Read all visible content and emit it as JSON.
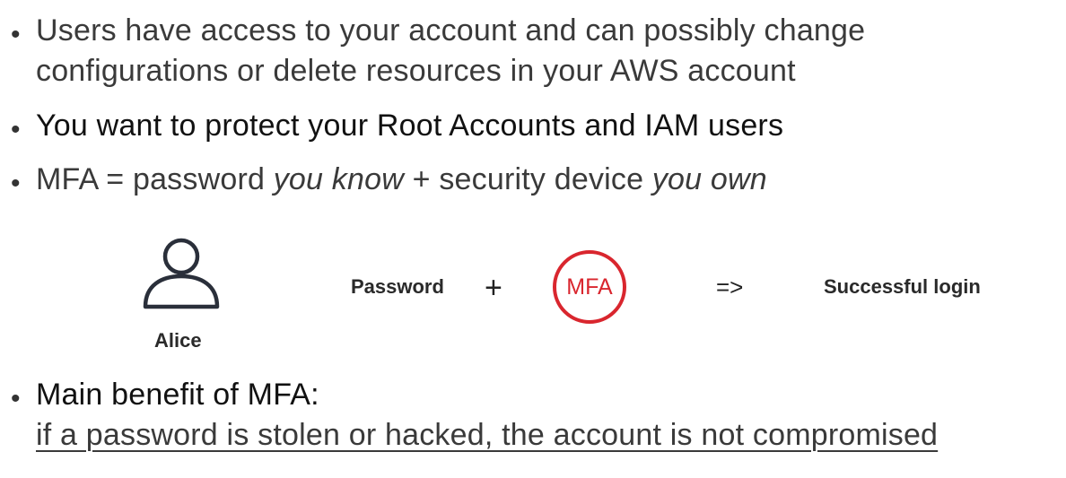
{
  "bullets": [
    {
      "line1": "Users have access to your account and can possibly change",
      "line2": "configurations or delete resources in your AWS account"
    },
    {
      "text": "You want to protect your Root Accounts and IAM users"
    },
    {
      "part1": "MFA = password ",
      "part2": "you know",
      "part3": " + security device ",
      "part4": "you own"
    },
    {
      "heading": "Main benefit of MFA:",
      "detail": "if a password is stolen or hacked, the account is not compromised"
    }
  ],
  "diagram": {
    "user_icon": "user-icon",
    "user_name": "Alice",
    "password_label": "Password",
    "plus": "+",
    "mfa_badge": "MFA",
    "arrow": "=>",
    "result": "Successful login",
    "accent_color": "#d9262e"
  }
}
